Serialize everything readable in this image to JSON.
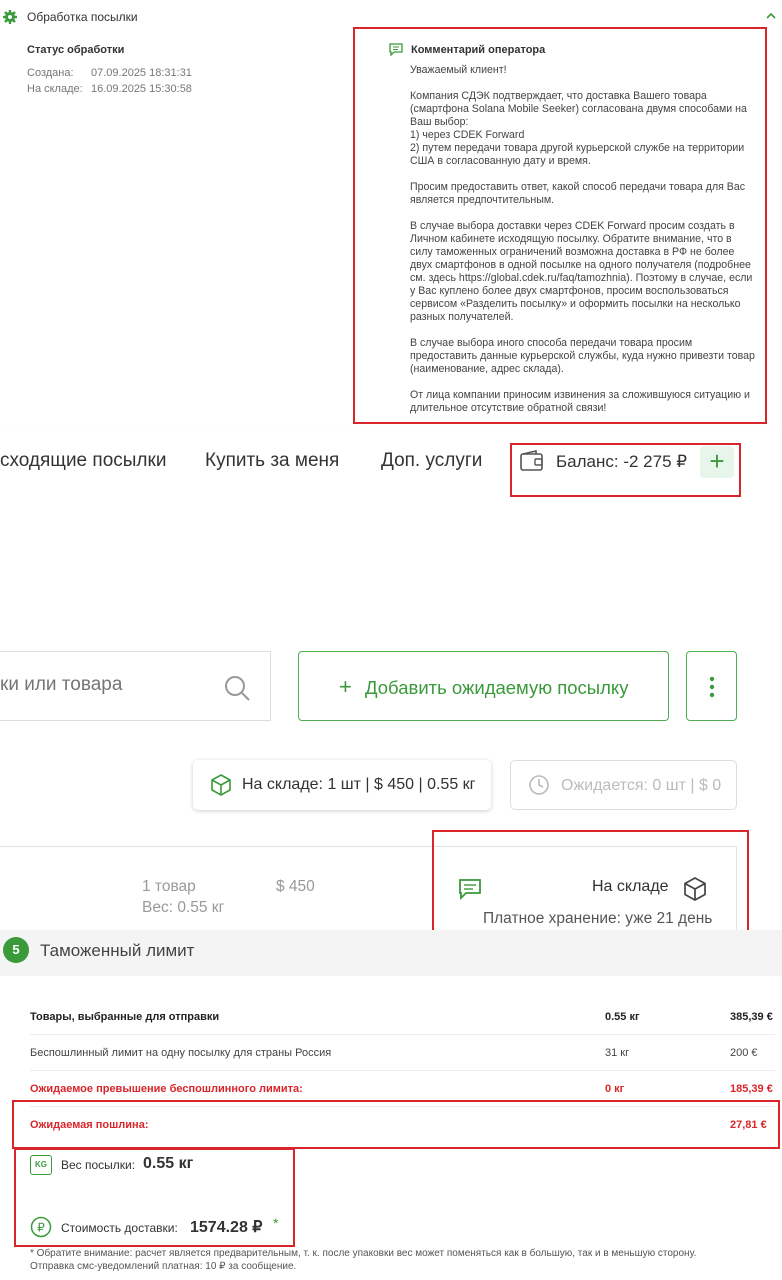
{
  "panel": {
    "title": "Обработка посылки",
    "status_heading": "Статус обработки",
    "created_label": "Создана:",
    "created_value": "07.09.2025 18:31:31",
    "warehouse_label": "На складе:",
    "warehouse_value": "16.09.2025 15:30:58",
    "comment_title": "Комментарий оператора",
    "comment_text": "Уважаемый клиент!\n\nКомпания СДЭК подтверждает, что доставка Вашего товара (смартфона Solana Mobile Seeker) согласована двумя способами на Ваш выбор:\n1) через CDEK Forward\n2) путем передачи товара другой курьерской службе на территории США в согласованную дату и время.\n\nПросим предоставить ответ, какой способ передачи товара для Вас является предпочтительным.\n\nВ случае выбора доставки через CDEK Forward просим создать в Личном кабинете исходящую посылку. Обратите внимание, что в силу таможенных ограничений возможна доставка в РФ не более двух смартфонов в одной посылке на одного получателя (подробнее см. здесь https://global.cdek.ru/faq/tamozhnia). Поэтому в случае, если у Вас куплено более двух смартфонов, просим воспользоваться сервисом «Разделить посылку» и оформить посылки на несколько разных получателей.\n\nВ случае выбора иного способа передачи товара просим предоставить данные курьерской службы, куда нужно привезти товар (наименование, адрес склада).\n\nОт лица компании приносим извинения за сложившуюся ситуацию и длительное отсутствие обратной связи!"
  },
  "nav": {
    "outgoing": "сходящие посылки",
    "buy_for_me": "Купить за меня",
    "extra_services": "Доп. услуги",
    "balance": "Баланс: -2 275 ₽",
    "plus": "+"
  },
  "toolbar": {
    "search_placeholder": "ки или товара",
    "add_label": "Добавить ожидаемую посылку",
    "add_plus": "+"
  },
  "chips": {
    "warehouse": "На складе: 1 шт | $ 450 | 0.55 кг",
    "expected": "Ожидается: 0 шт | $ 0"
  },
  "parcel": {
    "items": "1 товар",
    "weight": "Вес: 0.55 кг",
    "price": "$ 450",
    "status": "На складе",
    "storage": "Платное хранение: уже 21 день"
  },
  "customs": {
    "step": "5",
    "title": "Таможенный лимит",
    "rows": [
      {
        "label": "Товары, выбранные для отправки",
        "kg": "0.55 кг",
        "eur": "385,39 €"
      },
      {
        "label": "Беспошлинный лимит на одну посылку для страны Россия",
        "kg": "31 кг",
        "eur": "200 €"
      },
      {
        "label": "Ожидаемое превышение беспошлинного лимита:",
        "kg": "0 кг",
        "eur": "185,39 €"
      },
      {
        "label": "Ожидаемая пошлина:",
        "kg": "",
        "eur": "27,81 €"
      }
    ]
  },
  "summary": {
    "weight_label": "Вес посылки:",
    "weight_value": "0.55 кг",
    "kg_badge": "KG",
    "cost_label": "Стоимость доставки:",
    "cost_value": "1574.28 ₽",
    "cost_star": "*",
    "note": "* Обратите внимание: расчет является предварительным, т. к. после упаковки вес может поменяться как в большую, так и в меньшую сторону. Отправка смс-уведомлений платная: 10 ₽ за сообщение."
  },
  "colors": {
    "accent": "#3a9a3a",
    "alert": "#d9262b"
  }
}
